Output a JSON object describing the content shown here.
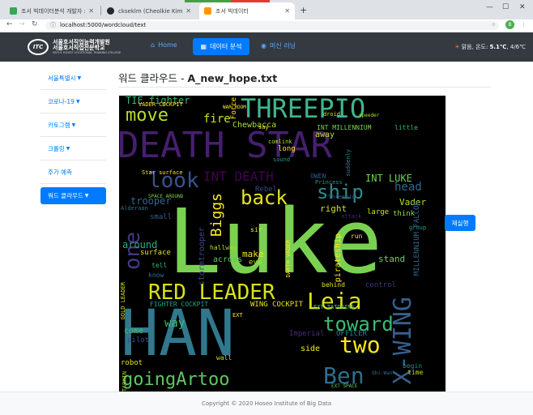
{
  "browser": {
    "tabs": [
      {
        "title": "조서 빅데이터분석 개발자 : 웨",
        "favicon_color": "#34a853"
      },
      {
        "title": "ckseklm (Cheolkie Kim)",
        "favicon_color": "#24292e"
      },
      {
        "title": "조서 빅데이터",
        "favicon_color": "#ff9800"
      }
    ],
    "url": "localhost:5000/wordcloud/text",
    "profile_initial": "B"
  },
  "navbar": {
    "logo_mark": "ITC",
    "logo_line1": "서울호서직업능력개발원",
    "logo_line2": "서울호서직업전문학교",
    "logo_line3": "SEOUL HOSEO VOCATIONAL TRAINING COLLEGE",
    "home": "Home",
    "data_analysis": "데이터 분석",
    "machine_learning": "머신 러닝",
    "weather_label": "맑음, 온도: ",
    "weather_temp": "5.1℃",
    "weather_range": ", 4/6℃"
  },
  "sidebar": {
    "items": [
      {
        "label": "서울특별시",
        "dropdown": true
      },
      {
        "label": "코로나-19",
        "dropdown": true
      },
      {
        "label": "카토그램",
        "dropdown": true
      },
      {
        "label": "크롤링",
        "dropdown": true
      },
      {
        "label": "주가 예측",
        "dropdown": false
      },
      {
        "label": "워드 클라우드",
        "dropdown": true
      }
    ]
  },
  "main": {
    "title_prefix": "워드 클라우드 - ",
    "title_file": "A_new_hope.txt",
    "rerun_label": "재실행"
  },
  "wordcloud": {
    "words": [
      {
        "text": "THREEPIO",
        "color": "#3fb68d",
        "size": 32
      },
      {
        "text": "DEATH STAR",
        "color": "#461f6e",
        "size": 44
      },
      {
        "text": "Luke",
        "color": "#7ad151",
        "size": 110
      },
      {
        "text": "HAN",
        "color": "#31788d",
        "size": 78
      },
      {
        "text": "RED LEADER",
        "color": "#d8e21b",
        "size": 26
      },
      {
        "text": "Leia",
        "color": "#d8e21b",
        "size": 28
      },
      {
        "text": "move",
        "color": "#b7de2a",
        "size": 22
      },
      {
        "text": "look",
        "color": "#3a538b",
        "size": 26
      },
      {
        "text": "back",
        "color": "#e5e419",
        "size": 24
      },
      {
        "text": "ship",
        "color": "#2c8c8d",
        "size": 24
      },
      {
        "text": "INT DEATH",
        "color": "#440154",
        "size": 16
      },
      {
        "text": "toward",
        "color": "#3bbb75",
        "size": 24
      },
      {
        "text": "two",
        "color": "#f6e620",
        "size": 28
      },
      {
        "text": "Ben",
        "color": "#2d6e8e",
        "size": 28
      },
      {
        "text": "goingArtoo",
        "color": "#5cc863",
        "size": 22
      },
      {
        "text": "one",
        "color": "#443983",
        "size": 26
      },
      {
        "text": "X-WING",
        "color": "#34608d",
        "size": 30
      },
      {
        "text": "Biggs",
        "color": "#fde725",
        "size": 18
      },
      {
        "text": "TIE fighter",
        "color": "#35b779",
        "size": 12
      },
      {
        "text": "fire",
        "color": "#d2e21b",
        "size": 14
      },
      {
        "text": "Chewbacca",
        "color": "#a8db34",
        "size": 10
      },
      {
        "text": "Force",
        "color": "#fde725",
        "size": 9
      },
      {
        "text": "INT LUKE",
        "color": "#6ece58",
        "size": 12
      },
      {
        "text": "head",
        "color": "#2f6b8e",
        "size": 14
      },
      {
        "text": "Vader",
        "color": "#b5de2b",
        "size": 11
      },
      {
        "text": "think",
        "color": "#9dd93b",
        "size": 9
      },
      {
        "text": "large",
        "color": "#d0e11c",
        "size": 9
      },
      {
        "text": "right",
        "color": "#cde11d",
        "size": 11
      },
      {
        "text": "trooper",
        "color": "#31678e",
        "size": 12
      },
      {
        "text": "around",
        "color": "#27ad81",
        "size": 12
      },
      {
        "text": "surface",
        "color": "#e5e419",
        "size": 9
      },
      {
        "text": "stormtrooper",
        "color": "#3f4889",
        "size": 10
      },
      {
        "text": "across",
        "color": "#5ac864",
        "size": 10
      },
      {
        "text": "make",
        "color": "#fde725",
        "size": 11
      },
      {
        "text": "eye",
        "color": "#bddf26",
        "size": 9
      },
      {
        "text": "Rebel",
        "color": "#3e4a89",
        "size": 9
      },
      {
        "text": "pirateship",
        "color": "#fde725",
        "size": 10
      },
      {
        "text": "stand",
        "color": "#73d056",
        "size": 11
      },
      {
        "text": "control",
        "color": "#46327e",
        "size": 9
      },
      {
        "text": "way",
        "color": "#3dbc74",
        "size": 14
      },
      {
        "text": "OFFICER",
        "color": "#26828e",
        "size": 9
      },
      {
        "text": "side",
        "color": "#fde725",
        "size": 10
      },
      {
        "text": "come",
        "color": "#4ac16d",
        "size": 10
      },
      {
        "text": "robot",
        "color": "#e5e419",
        "size": 9
      },
      {
        "text": "time",
        "color": "#c0df25",
        "size": 8
      },
      {
        "text": "begin",
        "color": "#21918c",
        "size": 8
      },
      {
        "text": "Imperial",
        "color": "#472d7b",
        "size": 9
      },
      {
        "text": "FIGHTER COCKPIT",
        "color": "#1fa187",
        "size": 8
      },
      {
        "text": "WING COCKPIT",
        "color": "#e5e419",
        "size": 9
      },
      {
        "text": "MILLENNIUM FALCON",
        "color": "#31678e",
        "size": 9
      },
      {
        "text": "VADER COCKPIT",
        "color": "#fde725",
        "size": 7
      },
      {
        "text": "INT MILLENNIUM",
        "color": "#7ad151",
        "size": 8
      },
      {
        "text": "OWEN",
        "color": "#375a8c",
        "size": 8
      },
      {
        "text": "wall",
        "color": "#bddf26",
        "size": 8
      },
      {
        "text": "long",
        "color": "#fde725",
        "size": 9
      },
      {
        "text": "away",
        "color": "#c2df23",
        "size": 10
      },
      {
        "text": "Alderaan",
        "color": "#2d708e",
        "size": 7
      },
      {
        "text": "hallway",
        "color": "#addc30",
        "size": 8
      },
      {
        "text": "sound",
        "color": "#1fa088",
        "size": 7
      },
      {
        "text": "GOLD LEADER",
        "color": "#d8e21b",
        "size": 7
      },
      {
        "text": "DARTH VADER",
        "color": "#fde725",
        "size": 7
      },
      {
        "text": "EXT TATOOINE",
        "color": "#5cc863",
        "size": 7
      },
      {
        "text": "EXT",
        "color": "#f1e51d",
        "size": 7
      },
      {
        "text": "small",
        "color": "#355f8d",
        "size": 9
      },
      {
        "text": "pilot",
        "color": "#3b528b",
        "size": 9
      },
      {
        "text": "behind",
        "color": "#e1e31a",
        "size": 8
      },
      {
        "text": "run",
        "color": "#fde725",
        "size": 8
      },
      {
        "text": "group",
        "color": "#20a486",
        "size": 7
      },
      {
        "text": "Princess",
        "color": "#1e9b8a",
        "size": 7
      },
      {
        "text": "say",
        "color": "#fde725",
        "size": 7
      },
      {
        "text": "comlink",
        "color": "#addc30",
        "size": 7
      },
      {
        "text": "tell",
        "color": "#35b779",
        "size": 8
      },
      {
        "text": "know",
        "color": "#2a788e",
        "size": 8
      },
      {
        "text": "WAR ROOM",
        "color": "#fde725",
        "size": 6
      },
      {
        "text": "SPACE AROUND",
        "color": "#7ad151",
        "size": 6
      },
      {
        "text": "droid",
        "color": "#d2e21b",
        "size": 7
      },
      {
        "text": "little",
        "color": "#35b779",
        "size": 8
      },
      {
        "text": "speeder",
        "color": "#b5de2b",
        "size": 6
      },
      {
        "text": "sir",
        "color": "#fde725",
        "size": 8
      },
      {
        "text": "Star surface",
        "color": "#fde725",
        "size": 7
      },
      {
        "text": "suddenly",
        "color": "#238a8d",
        "size": 7
      },
      {
        "text": "attack",
        "color": "#482878",
        "size": 7
      },
      {
        "text": "TARKIN",
        "color": "#a5db36",
        "size": 7
      },
      {
        "text": "Threepio",
        "color": "#3b528b",
        "size": 7
      },
      {
        "text": "EXT SPACE",
        "color": "#5ec962",
        "size": 6
      },
      {
        "text": "Obi-Wan",
        "color": "#31688e",
        "size": 6
      }
    ]
  },
  "footer": {
    "copyright": "Copyright © 2020 Hoseo Institute of Big Data"
  }
}
